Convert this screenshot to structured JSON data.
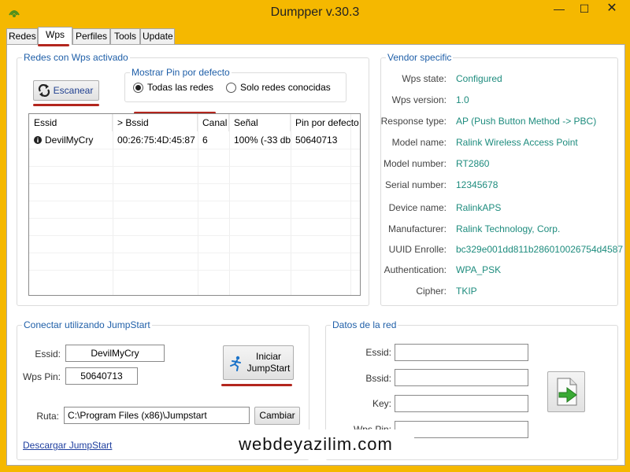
{
  "window": {
    "title": "Dumpper v.30.3",
    "minimize": "—",
    "maximize": "☐",
    "close": "✕"
  },
  "tabs": [
    "Redes",
    "Wps",
    "Perfiles",
    "Tools",
    "Update"
  ],
  "wps_group": {
    "title": "Redes con Wps activado",
    "scan_label": "Escanear",
    "pin_group_title": "Mostrar Pin por defecto",
    "radio_all": "Todas las redes",
    "radio_known": "Solo redes conocidas",
    "columns": [
      "Essid",
      "> Bssid",
      "Canal",
      "Señal",
      "Pin por defecto"
    ],
    "rows": [
      {
        "essid": "DevilMyCry",
        "bssid": "00:26:75:4D:45:87",
        "canal": "6",
        "senal": "100% (-33 db...",
        "pin": "50640713"
      }
    ]
  },
  "vendor": {
    "title": "Vendor specific",
    "fields": [
      {
        "label": "Wps state:",
        "value": "Configured"
      },
      {
        "label": "Wps version:",
        "value": "1.0"
      },
      {
        "label": "Response type:",
        "value": "AP (Push Button Method -> PBC)"
      },
      {
        "label": "Model name:",
        "value": "Ralink Wireless Access Point"
      },
      {
        "label": "Model number:",
        "value": "RT2860"
      },
      {
        "label": "Serial number:",
        "value": "12345678"
      },
      {
        "label": "Device name:",
        "value": "RalinkAPS"
      },
      {
        "label": "Manufacturer:",
        "value": "Ralink Technology, Corp."
      },
      {
        "label": "UUID Enrolle:",
        "value": "bc329e001dd811b286010026754d4587"
      },
      {
        "label": "Authentication:",
        "value": "WPA_PSK"
      },
      {
        "label": "Cipher:",
        "value": "TKIP"
      }
    ]
  },
  "jumpstart": {
    "title": "Conectar utilizando JumpStart",
    "essid_label": "Essid:",
    "essid_value": "DevilMyCry",
    "pin_label": "Wps Pin:",
    "pin_value": "50640713",
    "start_line1": "Iniciar",
    "start_line2": "JumpStart",
    "ruta_label": "Ruta:",
    "ruta_value": "C:\\Program Files (x86)\\Jumpstart",
    "cambiar_label": "Cambiar",
    "download_link": "Descargar JumpStart"
  },
  "network_data": {
    "title": "Datos de la red",
    "essid_label": "Essid:",
    "bssid_label": "Bssid:",
    "key_label": "Key:",
    "pin_label": "Wps Pin:"
  },
  "watermark": "webdeyazilim.com",
  "colors": {
    "accent_text": "#1f5fa8",
    "vendor_value": "#1e8c7e",
    "highlight_line": "#b3261e",
    "frame": "#f5b800"
  }
}
